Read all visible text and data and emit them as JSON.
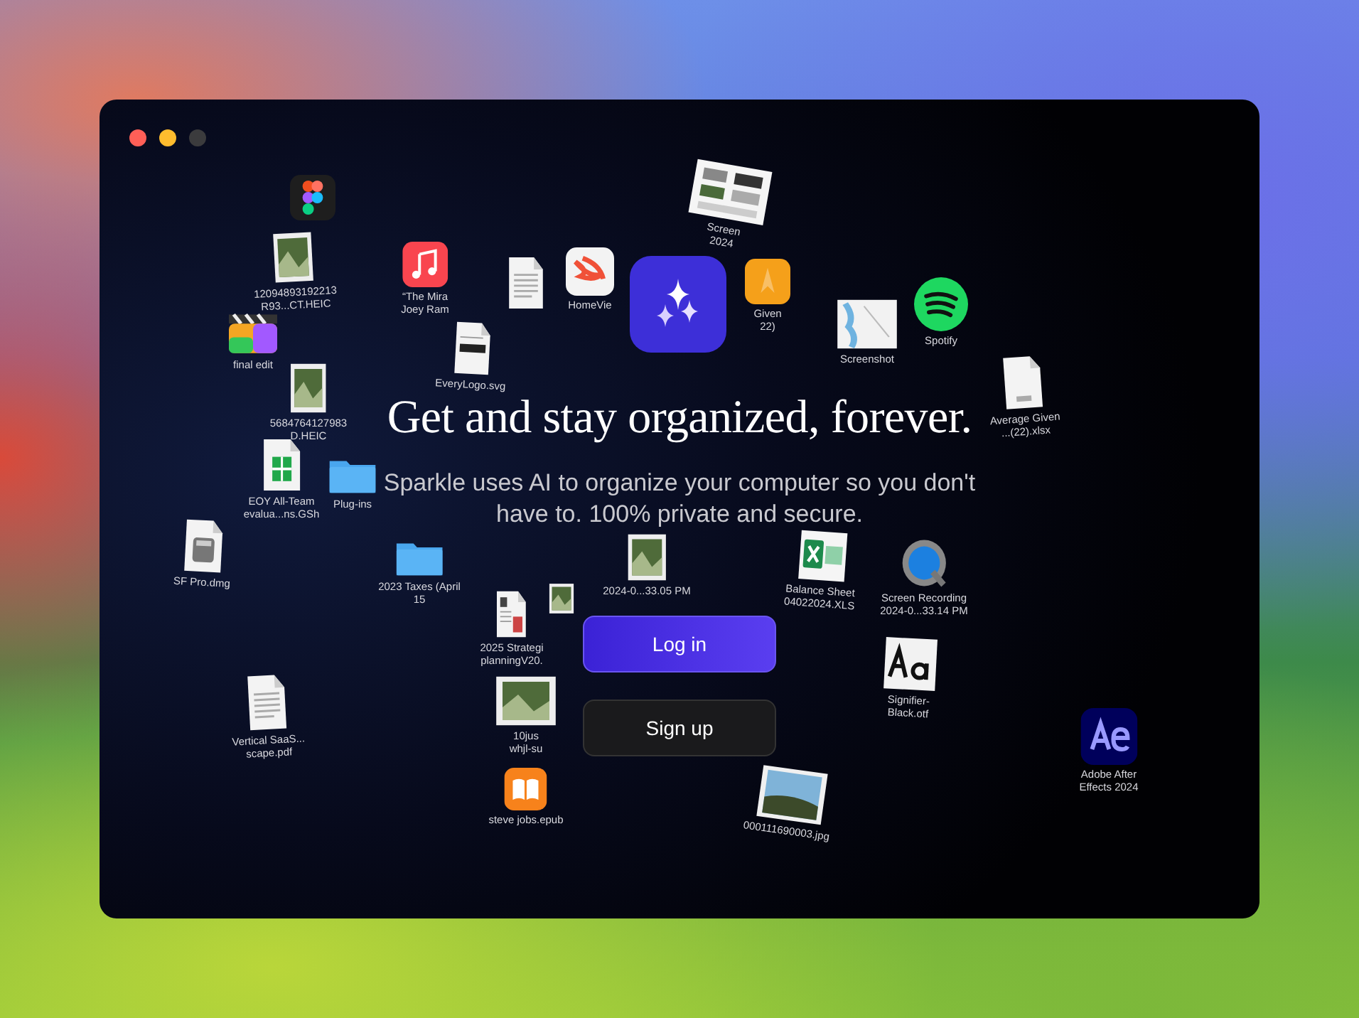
{
  "window": {
    "controls": [
      {
        "color": "#ff5f57"
      },
      {
        "color": "#febc2e"
      },
      {
        "color": "#3b3b3d"
      }
    ]
  },
  "files": [
    {
      "kind": "design"
    },
    {
      "kind": "photo",
      "label": [
        "12094893192213",
        "R93...CT.HEIC"
      ]
    },
    {
      "kind": "music",
      "label": [
        "“The Mira",
        "Joey Ram"
      ]
    },
    {
      "kind": "logo",
      "label": [
        "EveryLogo.svg"
      ]
    },
    {
      "kind": "video",
      "label": [
        "final edit"
      ]
    },
    {
      "kind": "photo",
      "label": [
        "5684764127983",
        "D.HEIC"
      ]
    },
    {
      "kind": "document"
    },
    {
      "kind": "folder",
      "label": [
        "Plug-ins"
      ]
    },
    {
      "kind": "folder",
      "label": [
        "2023 Taxes (April",
        "15"
      ]
    },
    {
      "kind": "sheet",
      "label": [
        "EOY All-Team",
        "evalua...ns.GSh"
      ]
    },
    {
      "kind": "disk",
      "label": [
        "SF Pro.dmg"
      ]
    },
    {
      "kind": "document",
      "label": [
        "Vertical SaaS...",
        "scape.pdf"
      ]
    },
    {
      "kind": "report",
      "label": [
        "2025 Strategi",
        "planningV20."
      ]
    },
    {
      "kind": "photo",
      "label": [
        "10jus",
        "whjl-su"
      ]
    },
    {
      "kind": "book",
      "label": [
        "steve jobs.epub"
      ]
    },
    {
      "kind": "swift",
      "label": [
        "HomeVie"
      ]
    },
    {
      "kind": "slides",
      "label": [
        "Screen",
        "2024"
      ]
    },
    {
      "kind": "orange",
      "label": [
        "Given",
        "22)"
      ]
    },
    {
      "kind": "map",
      "label": [
        "Screenshot"
      ]
    },
    {
      "kind": "waves",
      "label": [
        "Spotify"
      ]
    },
    {
      "kind": "xlsx",
      "label": [
        "Average Given",
        "...(22).xlsx"
      ]
    },
    {
      "kind": "photo",
      "label": [
        "2024-0...33.05 PM"
      ]
    },
    {
      "kind": "excel",
      "label": [
        "Balance Sheet",
        "04022024.XLS"
      ]
    },
    {
      "kind": "recording",
      "label": [
        "Screen Recording",
        "2024-0...33.14 PM"
      ]
    },
    {
      "kind": "photo"
    },
    {
      "kind": "font",
      "label": [
        "Signifier-",
        "Black.otf"
      ]
    },
    {
      "kind": "landscape",
      "label": [
        "000111690003.jpg"
      ]
    },
    {
      "kind": "ae",
      "label": [
        "Adobe After",
        "Effects 2024"
      ]
    }
  ],
  "app_icon": {
    "kind": "sparkle"
  },
  "headline": "Get and stay organized, forever.",
  "subtitle": "Sparkle uses AI to organize your computer so you don't have to. 100% private and secure.",
  "buttons": [
    {
      "label": "Log in",
      "kind": "primary"
    },
    {
      "label": "Sign up",
      "kind": "secondary"
    }
  ]
}
